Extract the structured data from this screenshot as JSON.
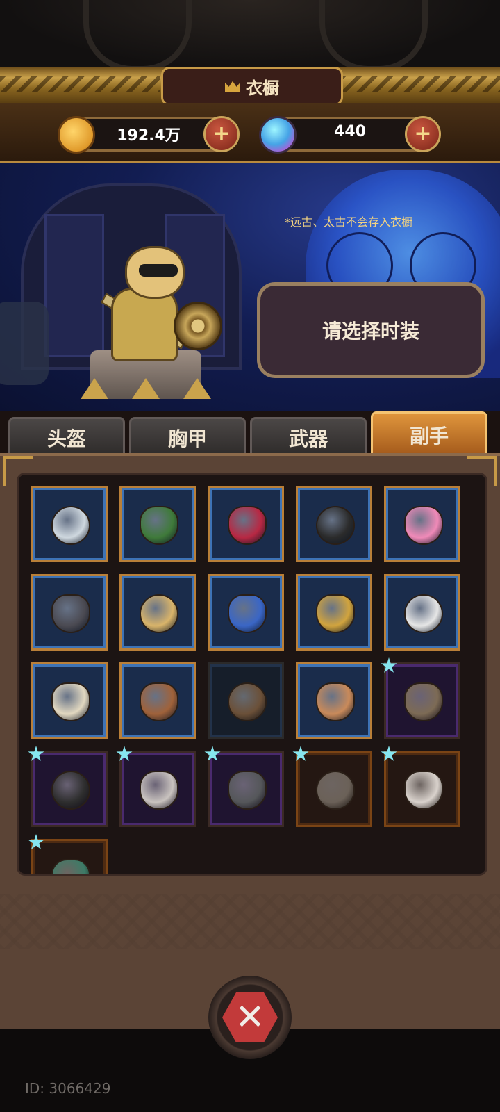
{
  "header": {
    "title": "衣橱",
    "title_icon": "crown-icon"
  },
  "currency": {
    "gold": {
      "icon": "gold-coin-icon",
      "value": "192.4万",
      "plus_icon": "plus-icon"
    },
    "gems": {
      "icon": "gem-icon",
      "value": "440",
      "plus_icon": "plus-icon"
    }
  },
  "scene": {
    "notice": "*远古、太古不会存入衣橱",
    "selection_prompt": "请选择时装"
  },
  "tabs": [
    {
      "label": "头盔",
      "active": false
    },
    {
      "label": "胸甲",
      "active": false
    },
    {
      "label": "武器",
      "active": false
    },
    {
      "label": "副手",
      "active": true
    }
  ],
  "items": [
    {
      "name": "round-ice-shield",
      "frame": "blue",
      "starred": false,
      "color": "#cfd8df"
    },
    {
      "name": "green-red-kite-shield",
      "frame": "blue",
      "starred": false,
      "color": "#3f7a3a"
    },
    {
      "name": "red-buckler",
      "frame": "blue",
      "starred": false,
      "color": "#b82843"
    },
    {
      "name": "black-gold-shield",
      "frame": "blue",
      "starred": false,
      "color": "#2b2b2b"
    },
    {
      "name": "pink-crown-shield",
      "frame": "blue",
      "starred": false,
      "color": "#f08ab8"
    },
    {
      "name": "dark-spiked-shield",
      "frame": "blue",
      "starred": false,
      "color": "#4b4a52"
    },
    {
      "name": "red-cross-shield",
      "frame": "blue",
      "starred": false,
      "color": "#d9b46a"
    },
    {
      "name": "blue-star-shield",
      "frame": "blue",
      "starred": false,
      "color": "#3a66c6"
    },
    {
      "name": "gold-crown-crest",
      "frame": "blue",
      "starred": false,
      "color": "#d1a43e"
    },
    {
      "name": "white-gold-arrow-shield",
      "frame": "blue",
      "starred": false,
      "color": "#e6e6e6"
    },
    {
      "name": "white-gold-tower-shield",
      "frame": "blue",
      "starred": false,
      "color": "#e2d8c0"
    },
    {
      "name": "wooden-tablet-shield",
      "frame": "blue",
      "starred": false,
      "color": "#a0623a"
    },
    {
      "name": "bronze-round-shield",
      "frame": "dark",
      "starred": false,
      "color": "#6b5038"
    },
    {
      "name": "leaf-pot-shield",
      "frame": "blue",
      "starred": false,
      "color": "#c98a5a"
    },
    {
      "name": "wooden-plank-shield",
      "frame": "purple",
      "starred": true,
      "color": "#7d6b55"
    },
    {
      "name": "black-round-shield",
      "frame": "purple",
      "starred": true,
      "color": "#2e2e2e"
    },
    {
      "name": "white-red-shield",
      "frame": "purple",
      "starred": true,
      "color": "#c9c3bf"
    },
    {
      "name": "iron-lock-shield",
      "frame": "purple",
      "starred": true,
      "color": "#55575a"
    },
    {
      "name": "dark-winged-shield",
      "frame": "orange",
      "starred": true,
      "color": "#6b6158"
    },
    {
      "name": "silver-ribbon-shield",
      "frame": "orange",
      "starred": true,
      "color": "#d9d2cc"
    },
    {
      "name": "green-hood-shield",
      "frame": "orange",
      "starred": true,
      "color": "#3d7c67"
    }
  ],
  "close_icon": "close-x-icon",
  "footer": {
    "id_text": "ID: 3066429"
  }
}
